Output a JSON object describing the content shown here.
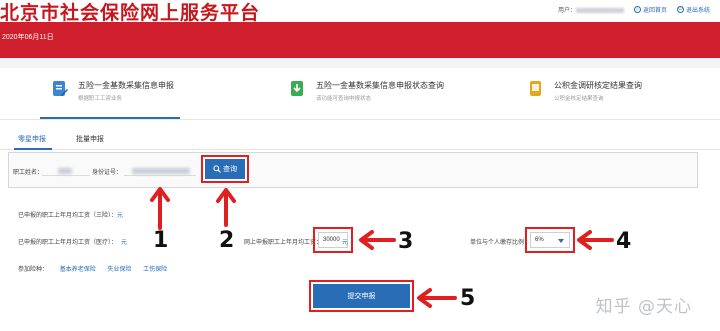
{
  "header": {
    "site_title": "北京市社会保险网上服务平台",
    "user_label": "用户：",
    "links": [
      {
        "label": "返回首页",
        "icon": "home-icon"
      },
      {
        "label": "退出系统",
        "icon": "logout-icon"
      }
    ],
    "date": "2020年06月11日"
  },
  "functions": [
    {
      "title": "五险一金基数采集信息申报",
      "subtitle": "根据职工工资业务",
      "icon": "edit-doc-icon",
      "color": "#3a86d4"
    },
    {
      "title": "五险一金基数采集信息申报状态查询",
      "subtitle": "该功能可查询申报状态",
      "icon": "download-doc-icon",
      "color": "#3daa55"
    },
    {
      "title": "公积金调研核定结果查询",
      "subtitle": "公积金核定结果查询",
      "icon": "note-icon",
      "color": "#e3a91e"
    }
  ],
  "tabs": [
    {
      "label": "零星申报",
      "active": true
    },
    {
      "label": "批量申报",
      "active": false
    }
  ],
  "search": {
    "name_label": "职工姓名：",
    "id_label": "身份证号：",
    "query_button": "查询"
  },
  "form": {
    "prev_wage_3_label": "已申报的职工上年月均工资（三险）：",
    "prev_wage_3_value": "元",
    "prev_wage_med_label": "已申报的职工上年月均工资（医疗）：",
    "prev_wage_med_value": "元",
    "online_wage_label": "网上申报职工上年月均工资：",
    "online_wage_value": "30000",
    "online_wage_unit": "元",
    "ratio_label": "单位与个人缴存比例：",
    "ratio_value": "6%",
    "insurance_label": "参加险种：",
    "insurance_types": [
      "基本养老保险",
      "失业保险",
      "工伤保险"
    ],
    "submit_button": "提交申报"
  },
  "annotations": [
    "1",
    "2",
    "3",
    "4",
    "5"
  ],
  "watermark": "知乎 @天心",
  "colors": {
    "brand_red": "#cf1f2c",
    "accent_blue": "#2a6db7",
    "annotation_red": "#e02020"
  }
}
